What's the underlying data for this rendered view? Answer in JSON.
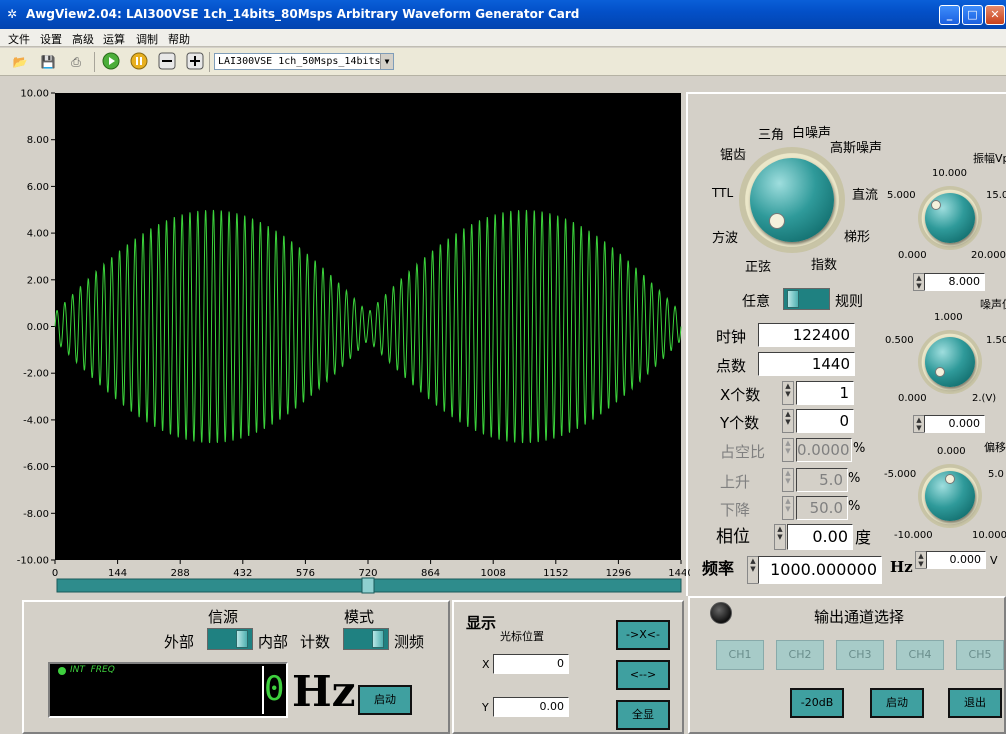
{
  "window": {
    "title": "AwgView2.04: LAI300VSE 1ch_14bits_80Msps Arbitrary Waveform Generator Card",
    "min": "_",
    "max": "□",
    "close": "✕"
  },
  "menu": [
    "文件",
    "设置",
    "高级",
    "运算",
    "调制",
    "帮助"
  ],
  "toolbar": {
    "device": "LAI300VSE 1ch_50Msps_14bits"
  },
  "chart_data": {
    "type": "line",
    "title": "",
    "xlabel": "",
    "ylabel": "",
    "xlim": [
      0,
      1440
    ],
    "ylim": [
      -10,
      10
    ],
    "yticks": [
      "10.00",
      "8.00",
      "6.00",
      "4.00",
      "2.00",
      "0.00",
      "-2.00",
      "-4.00",
      "-6.00",
      "-8.00",
      "-10.00"
    ],
    "xticks": [
      "0",
      "144",
      "288",
      "432",
      "576",
      "720",
      "864",
      "1008",
      "1152",
      "1296",
      "1440"
    ],
    "grid": false,
    "series": [
      {
        "color": "#3bd23b",
        "form": "am-modulated sine",
        "carrier_cycles": 80,
        "envelope_cycles": 2,
        "peak": 5.0,
        "envelope_min": 0.12,
        "x": [
          0,
          1440
        ]
      }
    ],
    "scroll_position": 720
  },
  "waveform": {
    "labels": {
      "saw": "锯齿",
      "tri": "三角",
      "white": "白噪声",
      "gauss": "高斯噪声",
      "ttl": "TTL",
      "dc": "直流",
      "square": "方波",
      "trap": "梯形",
      "sine": "正弦",
      "exp": "指数"
    },
    "mode_left": "任意",
    "mode_right": "规则"
  },
  "params": {
    "clock_label": "时钟",
    "clock": "122400",
    "points_label": "点数",
    "points": "1440",
    "xcount_label": "X个数",
    "xcount": "1",
    "ycount_label": "Y个数",
    "ycount": "0",
    "duty_label": "占空比",
    "duty": "0.0000",
    "pct": "%",
    "rise_label": "上升",
    "rise": "5.0",
    "fall_label": "下降",
    "fall": "50.0",
    "phase_label": "相位",
    "phase": "0.00",
    "deg": "度",
    "freq_label": "频率",
    "freq": "1000.000000",
    "hz": "Hz"
  },
  "amplitude": {
    "label": "振幅Vp",
    "t0": "0.000",
    "t5": "5.000",
    "t10": "10.000",
    "t15": "15.0",
    "t20": "20.000",
    "value": "8.000"
  },
  "noise": {
    "label": "噪声值",
    "t0": "0.000",
    "t05": "0.500",
    "t1": "1.000",
    "t15": "1.50",
    "t2": "2.(V)",
    "value": "0.000"
  },
  "offset": {
    "label": "偏移",
    "tm10": "-10.000",
    "tm5": "-5.000",
    "t0": "0.000",
    "t5": "5.0",
    "t10": "10.000",
    "value": "0.000",
    "unit": "V"
  },
  "counter": {
    "source_label": "信源",
    "ext": "外部",
    "int": "内部",
    "mode_label": "模式",
    "count": "计数",
    "measure": "测频",
    "indicator": "INT  FREQ",
    "display": "0",
    "unit": "Hz",
    "start": "启动"
  },
  "display": {
    "title": "显示",
    "cursor": "光标位置",
    "x_label": "X",
    "x_val": "0",
    "y_label": "Y",
    "y_val": "0.00",
    "zoom_in": "->X<-",
    "zoom_out": "<-->",
    "full": "全显"
  },
  "output": {
    "title": "输出通道选择",
    "channels": [
      "CH1",
      "CH2",
      "CH3",
      "CH4",
      "CH5"
    ],
    "atten": "-20dB",
    "start": "启动",
    "exit": "退出"
  }
}
